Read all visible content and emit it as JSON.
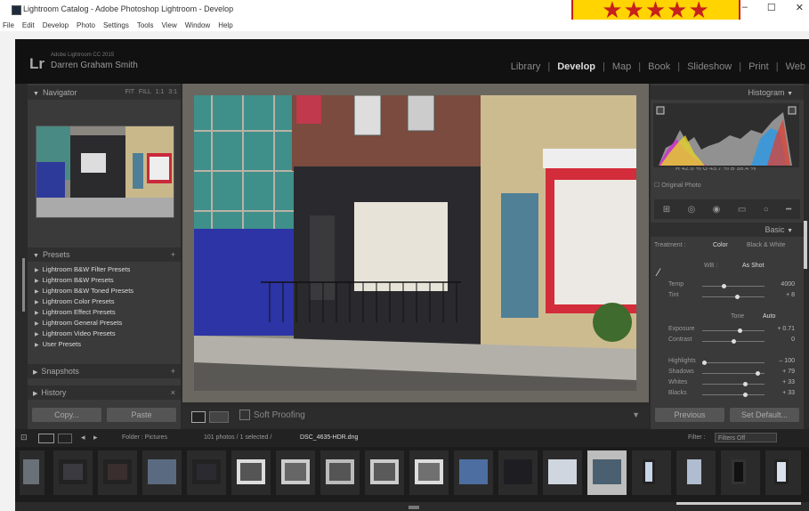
{
  "window": {
    "title": "Lightroom Catalog - Adobe Photoshop Lightroom - Develop",
    "controls": [
      "–",
      "☐",
      "✕"
    ],
    "rating": "★★★★★"
  },
  "menu": [
    "File",
    "Edit",
    "Develop",
    "Photo",
    "Settings",
    "Tools",
    "View",
    "Window",
    "Help"
  ],
  "identity": {
    "logo": "Lr",
    "subtitle": "Adobe Lightroom CC 2015",
    "name": "Darren Graham Smith"
  },
  "modules": [
    "Library",
    "Develop",
    "Map",
    "Book",
    "Slideshow",
    "Print",
    "Web"
  ],
  "active_module": "Develop",
  "left_panel": {
    "navigator": {
      "label": "Navigator",
      "zoom": "FIT FILL 1:1 3:1"
    },
    "presets": {
      "label": "Presets",
      "items": [
        "Lightroom B&W Filter Presets",
        "Lightroom B&W Presets",
        "Lightroom B&W Toned Presets",
        "Lightroom Color Presets",
        "Lightroom Effect Presets",
        "Lightroom General Presets",
        "Lightroom Video Presets",
        "User Presets"
      ]
    },
    "snapshots": "Snapshots",
    "history": "History",
    "copy": "Copy...",
    "paste": "Paste"
  },
  "toolbar": {
    "soft_proofing": "Soft Proofing"
  },
  "right_panel": {
    "histogram": {
      "label": "Histogram",
      "readout": "R 42.6 % G 43.7 % B 38.4 %",
      "original_photo": "Original Photo"
    },
    "basic": {
      "label": "Basic",
      "treatment": "Treatment :",
      "color": "Color",
      "bw": "Black & White",
      "wb_label": "WB :",
      "wb_value": "As Shot",
      "temp": {
        "label": "Temp",
        "value": "4000"
      },
      "tint": {
        "label": "Tint",
        "value": "+ 8"
      },
      "tone": "Tone",
      "auto": "Auto",
      "exposure": {
        "label": "Exposure",
        "value": "+ 0.71"
      },
      "contrast": {
        "label": "Contrast",
        "value": "0"
      },
      "highlights": {
        "label": "Highlights",
        "value": "– 100"
      },
      "shadows": {
        "label": "Shadows",
        "value": "+ 79"
      },
      "whites": {
        "label": "Whites",
        "value": "+ 33"
      },
      "blacks": {
        "label": "Blacks",
        "value": "+ 33"
      }
    },
    "previous": "Previous",
    "set_default": "Set Default..."
  },
  "filmbar": {
    "path": "Folder : Pictures",
    "count": "101 photos / 1 selected /",
    "file": "DSC_4635-HDR.dng",
    "filter_label": "Filter :",
    "filter_value": "Filters Off"
  },
  "colors": {
    "accent_yellow": "#ffd400",
    "accent_red": "#c8201a",
    "panel": "#3a3a3a",
    "background": "#2a2a2a"
  }
}
